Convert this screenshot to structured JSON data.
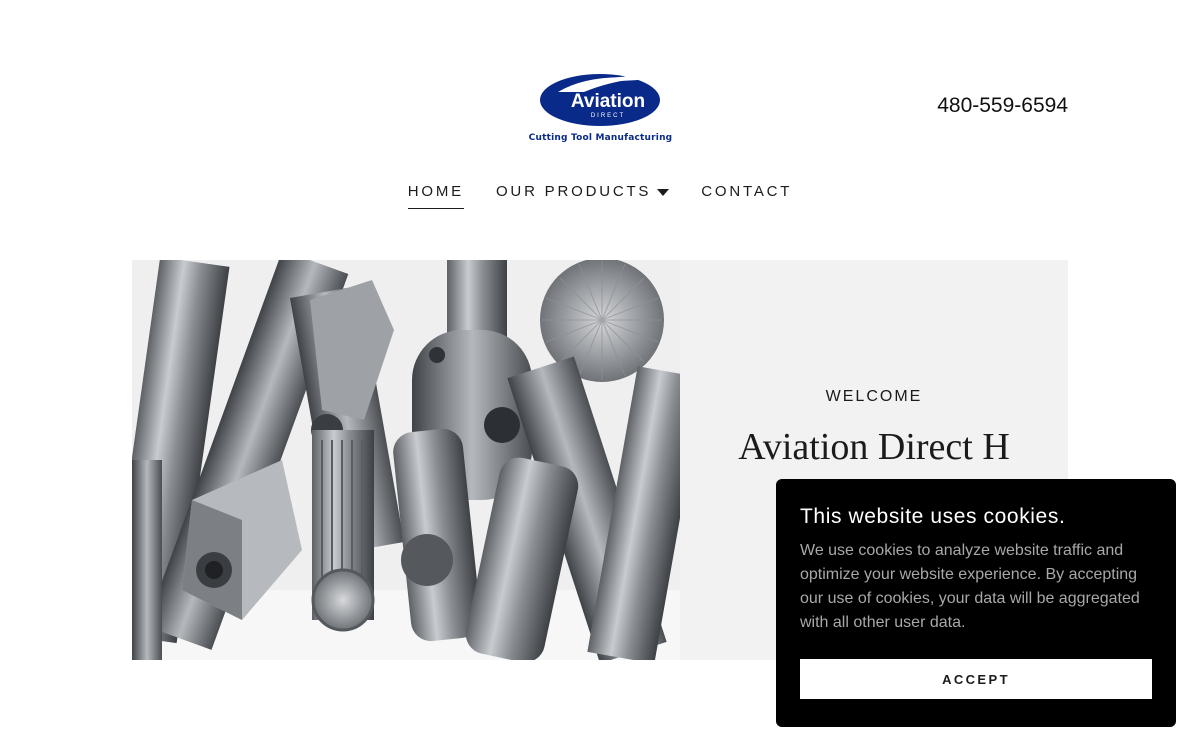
{
  "header": {
    "logo_text": "Aviation",
    "logo_subtext": "DIRECT",
    "logo_tagline": "Cutting Tool Manufacturing",
    "phone": "480-559-6594"
  },
  "nav": {
    "items": [
      {
        "label": "HOME",
        "active": true
      },
      {
        "label": "OUR PRODUCTS",
        "has_dropdown": true
      },
      {
        "label": "CONTACT"
      }
    ]
  },
  "hero": {
    "eyebrow": "WELCOME",
    "title": "Aviation Direct H"
  },
  "cookie_banner": {
    "title": "This website uses cookies.",
    "body": "We use cookies to analyze website traffic and optimize your website experience. By accepting our use of cookies, your data will be aggregated with all other user data.",
    "accept_label": "ACCEPT"
  },
  "colors": {
    "brand_blue": "#0a2a8a",
    "panel_bg": "#f2f2f2",
    "banner_bg": "#000000"
  }
}
